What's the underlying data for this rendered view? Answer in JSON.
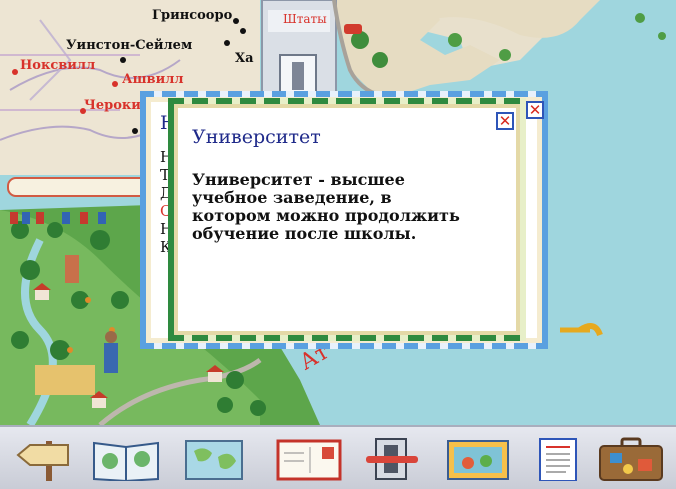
{
  "map": {
    "cities_black": [
      "Гринсооро",
      "Уинстон-Сейлем",
      "Ха"
    ],
    "cities_red": [
      "Ноксвилл",
      "Ашвилл",
      "Чероки"
    ],
    "states_label": "Штаты",
    "ocean_fragment": "Ат"
  },
  "back_dialog": {
    "title_fragment": "Н",
    "body_fragment": [
      "Н",
      "Т",
      "Д",
      "С",
      "Н",
      "К"
    ],
    "close_symbol": "✕"
  },
  "dialog": {
    "title": "Университет",
    "body": "Университет - высшее учебное заведение, в котором можно продолжить обучение после школы.",
    "close_symbol": "✕"
  },
  "toolbar": {
    "items": [
      "back-signpost",
      "atlas-book",
      "world-map",
      "postcard",
      "slide-viewer",
      "picture-card",
      "checklist",
      "suitcase"
    ]
  },
  "colors": {
    "ocean": "#9fd6de",
    "land": "#eee4d2",
    "dialog_green": "#2e8a3f",
    "dialog_blue": "#5aa0e0",
    "title_blue": "#1f2a8a",
    "close_red": "#d82a20"
  }
}
